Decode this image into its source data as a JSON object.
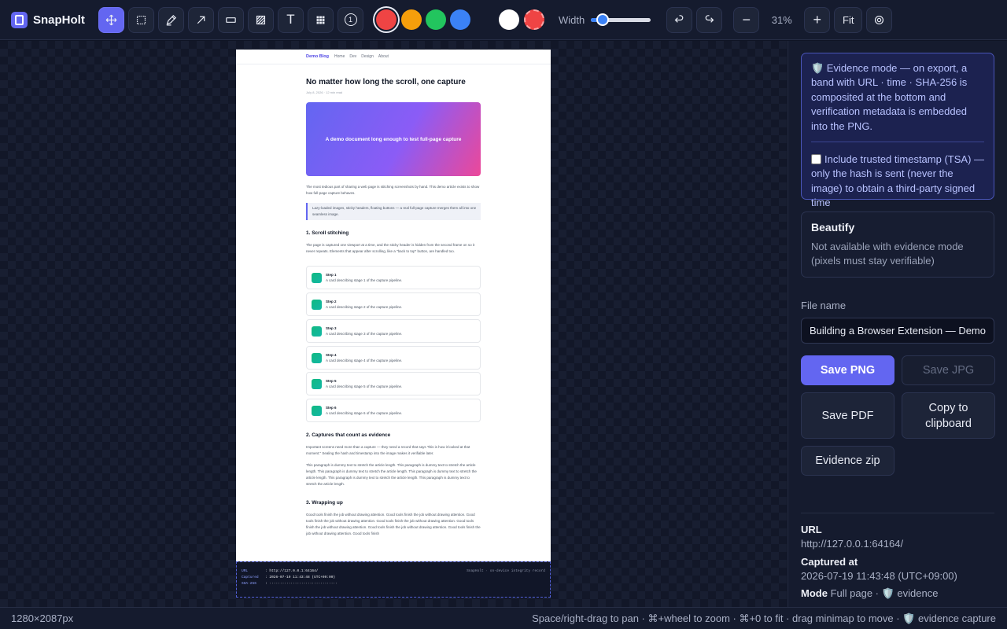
{
  "app": {
    "name": "SnapHolt",
    "logo_icon": "logo-icon"
  },
  "toolbar": {
    "tools": [
      {
        "name": "move-tool",
        "icon": "move-icon",
        "active": true
      },
      {
        "name": "select-rect-tool",
        "icon": "dashed-rect-icon"
      },
      {
        "name": "pen-tool",
        "icon": "pencil-icon"
      },
      {
        "name": "arrow-tool",
        "icon": "arrow-icon"
      },
      {
        "name": "rect-tool",
        "icon": "rect-icon"
      },
      {
        "name": "blur-tool",
        "icon": "hatch-icon"
      },
      {
        "name": "text-tool",
        "icon": "text-icon",
        "glyph": "T"
      },
      {
        "name": "mosaic-tool",
        "icon": "mosaic-icon"
      },
      {
        "name": "number-tool",
        "icon": "number-icon",
        "glyph": "1"
      }
    ],
    "colors": [
      "#ef4444",
      "#f59e0b",
      "#22c55e",
      "#3b82f6"
    ],
    "selected_color": "#ef4444",
    "fill_colors": [
      "#ffffff",
      "#ef4444"
    ],
    "width_label": "Width",
    "width_value": 0.2,
    "zoom_out": "−",
    "zoom_level": "31%",
    "zoom_in": "+",
    "fit": "Fit"
  },
  "document": {
    "nav": {
      "brand": "Demo Blog",
      "links": [
        "Home",
        "Dev",
        "Design",
        "About"
      ]
    },
    "title": "No matter how long the scroll, one capture",
    "date": "July 8, 2026 · 12 min read",
    "hero": "A demo document long enough to test full-page capture",
    "intro": "The most tedious part of sharing a web page is stitching screenshots by hand. This demo article exists to show how full-page capture behaves.",
    "quote": "Lazy-loaded images, sticky headers, floating buttons — a real full-page capture merges them all into one seamless image.",
    "h1": "1. Scroll stitching",
    "p1": "The page is captured one viewport at a time, and the sticky header is hidden from the second frame on so it never repeats. Elements that appear after scrolling, like a \"back to top\" button, are handled too.",
    "cards": [
      {
        "title": "Step 1",
        "desc": "A card describing stage 1 of the capture pipeline."
      },
      {
        "title": "Step 2",
        "desc": "A card describing stage 2 of the capture pipeline."
      },
      {
        "title": "Step 3",
        "desc": "A card describing stage 3 of the capture pipeline."
      },
      {
        "title": "Step 4",
        "desc": "A card describing stage 4 of the capture pipeline."
      },
      {
        "title": "Step 5",
        "desc": "A card describing stage 5 of the capture pipeline."
      },
      {
        "title": "Step 6",
        "desc": "A card describing stage 6 of the capture pipeline."
      }
    ],
    "h2": "2. Captures that count as evidence",
    "p2": "Important screens need more than a capture — they need a record that says \"this is how it looked at that moment.\" Sealing the hash and timestamp into the image makes it verifiable later.",
    "p3": "This paragraph is dummy text to stretch the article length. This paragraph is dummy text to stretch the article length. This paragraph is dummy text to stretch the article length. This paragraph is dummy text to stretch the article length. This paragraph is dummy text to stretch the article length. This paragraph is dummy text to stretch the article length.",
    "h3": "3. Wrapping up",
    "p4": "Good tools finish the job without drawing attention. Good tools finish the job without drawing attention. Good tools finish the job without drawing attention. Good tools finish the job without drawing attention. Good tools finish the job without drawing attention. Good tools finish the job without drawing attention. Good tools finish the job without drawing attention. Good tools finish"
  },
  "band": {
    "url_key": "URL",
    "url_val": ": http://127.0.0.1:64164/",
    "captured_key": "Captured",
    "captured_val": ": 2026-07-19 11:43:48 (UTC+09:00)",
    "sha_key": "SHA-256",
    "sha_val": ": ································",
    "brand": "SnapHolt · on-device integrity record"
  },
  "sidebar": {
    "evidence_note": "🛡️ Evidence mode — on export, a band with URL · time · SHA-256 is composited at the bottom and verification metadata is embedded into the PNG.",
    "tsa_label": "Include trusted timestamp (TSA) — only the hash is sent (never the image) to obtain a third-party signed time",
    "tsa_checked": false,
    "beautify_title": "Beautify",
    "beautify_desc": "Not available with evidence mode (pixels must stay verifiable)",
    "file_name_label": "File name",
    "file_name_value": "Building a Browser Extension — Demo Blog",
    "save_png": "Save PNG",
    "save_jpg": "Save JPG",
    "save_pdf": "Save PDF",
    "copy_clipboard": "Copy to clipboard",
    "evidence_zip": "Evidence zip",
    "meta": {
      "url_label": "URL",
      "url_value": "http://127.0.0.1:64164/",
      "captured_label": "Captured at",
      "captured_value": "2026-07-19 11:43:48 (UTC+09:00)",
      "mode_label": "Mode",
      "mode_value": "Full page · 🛡️ evidence"
    }
  },
  "status": {
    "dimensions": "1280×2087px",
    "hint": "Space/right-drag to pan · ⌘+wheel to zoom · ⌘+0 to fit · drag minimap to move · 🛡️ evidence capture"
  }
}
